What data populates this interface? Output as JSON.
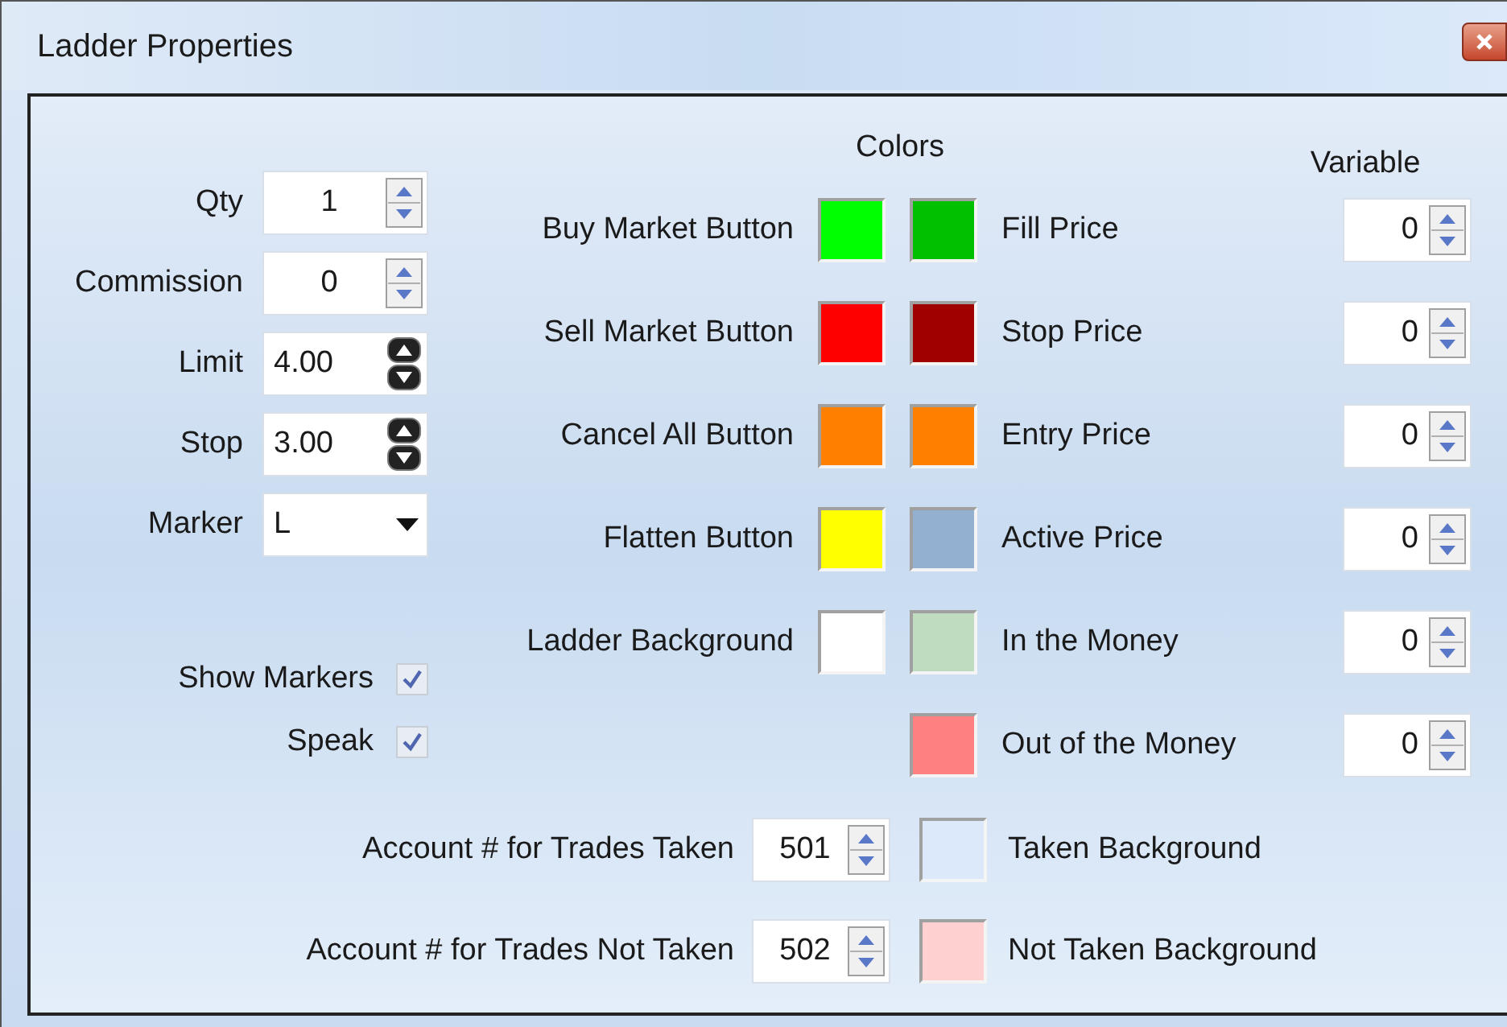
{
  "window": {
    "title": "Ladder Properties"
  },
  "settings": [
    {
      "label": "Qty",
      "value": "1",
      "kind": "spin"
    },
    {
      "label": "Commission",
      "value": "0",
      "kind": "spin"
    },
    {
      "label": "Limit",
      "value": "4.00",
      "kind": "stepper"
    },
    {
      "label": "Stop",
      "value": "3.00",
      "kind": "stepper"
    },
    {
      "label": "Marker",
      "value": "L",
      "kind": "dropdown"
    }
  ],
  "checkboxes": [
    {
      "label": "Show Markers",
      "checked": true
    },
    {
      "label": "Speak",
      "checked": true
    }
  ],
  "colors_heading": "Colors",
  "variable_heading": "Variable",
  "buttons": [
    {
      "label": "Buy Market Button",
      "color": "#00ff00"
    },
    {
      "label": "Sell Market Button",
      "color": "#ff0000"
    },
    {
      "label": "Cancel All Button",
      "color": "#ff8000"
    },
    {
      "label": "Flatten Button",
      "color": "#ffff00"
    },
    {
      "label": "Ladder Background",
      "color": "#ffffff"
    }
  ],
  "prices": [
    {
      "label": "Fill Price",
      "color": "#00c000",
      "variable": "0"
    },
    {
      "label": "Stop Price",
      "color": "#a00000",
      "variable": "0"
    },
    {
      "label": "Entry Price",
      "color": "#ff8000",
      "variable": "0"
    },
    {
      "label": "Active Price",
      "color": "#94b0d0",
      "variable": "0"
    },
    {
      "label": "In the Money",
      "color": "#c0dcc0",
      "variable": "0"
    },
    {
      "label": "Out of the Money",
      "color": "#ff8080",
      "variable": "0"
    }
  ],
  "accounts": [
    {
      "label": "Account # for Trades Taken",
      "value": "501",
      "color": "#dbe9fa",
      "background_label": "Taken Background"
    },
    {
      "label": "Account # for Trades Not Taken",
      "value": "502",
      "color": "#ffd0d0",
      "background_label": "Not Taken Background"
    }
  ]
}
